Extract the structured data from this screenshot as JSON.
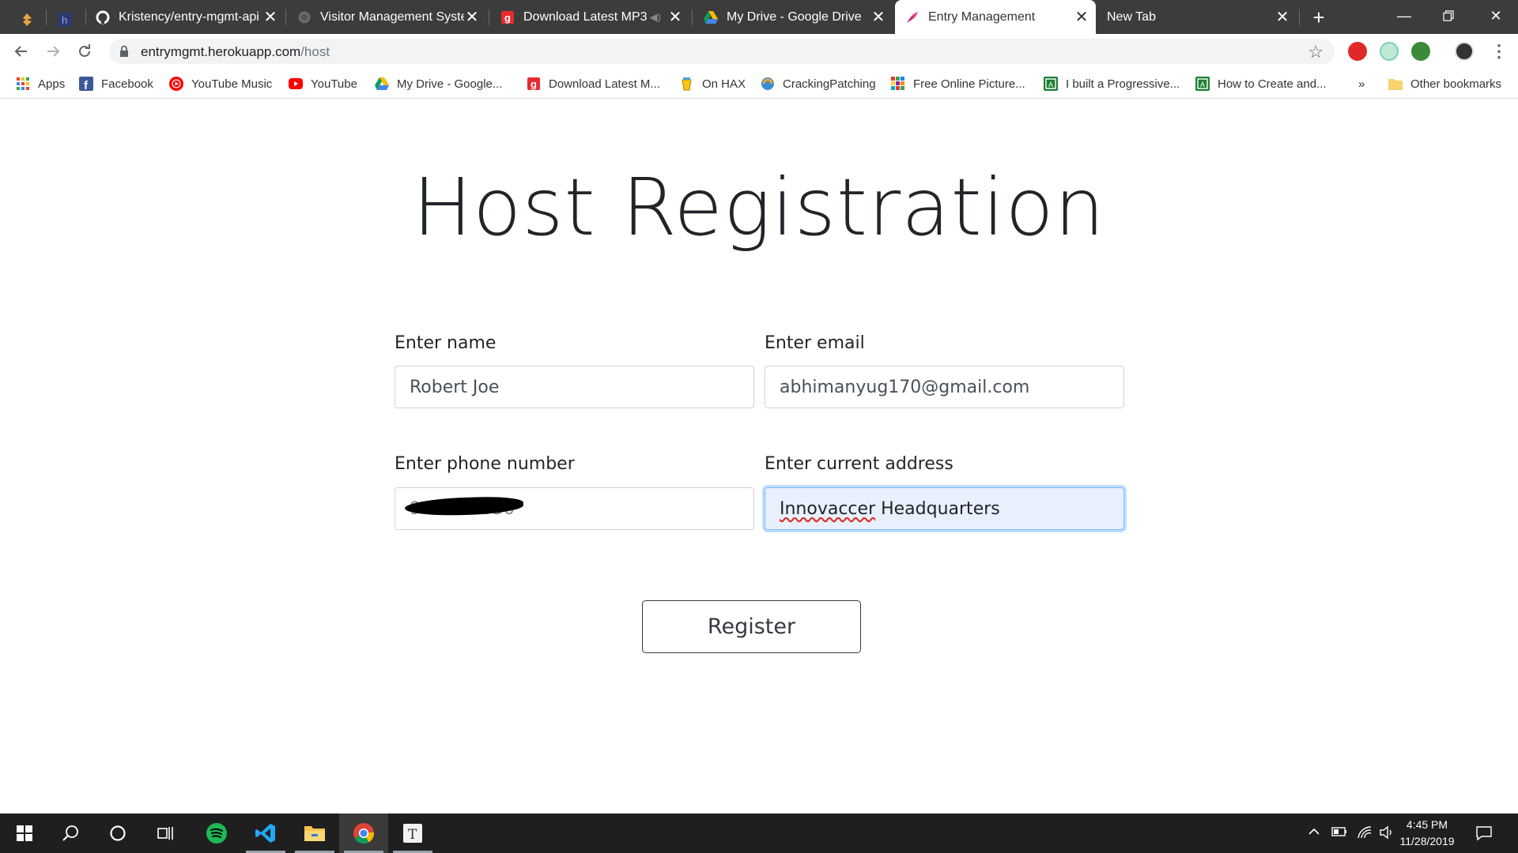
{
  "browser": {
    "tabs": [
      {
        "title": "Kristency/entry-mgmt-api",
        "icon": "github-icon"
      },
      {
        "title": "Visitor Management Syste",
        "icon": "globe-icon"
      },
      {
        "title": "Download Latest MP3",
        "icon": "gaana-icon"
      },
      {
        "title": "My Drive - Google Drive",
        "icon": "google-drive-icon"
      },
      {
        "title": "Entry Management",
        "icon": "feather-icon",
        "active": true
      },
      {
        "title": "New Tab",
        "icon": ""
      }
    ],
    "close_glyph": "✕",
    "url_host": "entrymgmt.herokuapp.com",
    "url_path": "/host",
    "bookmarks": [
      {
        "label": "Apps",
        "icon": "apps-grid-icon"
      },
      {
        "label": "Facebook",
        "icon": "facebook-icon"
      },
      {
        "label": "YouTube Music",
        "icon": "youtube-music-icon"
      },
      {
        "label": "YouTube",
        "icon": "youtube-icon"
      },
      {
        "label": "My Drive - Google...",
        "icon": "google-drive-icon"
      },
      {
        "label": "Download Latest M...",
        "icon": "gaana-icon"
      },
      {
        "label": "On HAX",
        "icon": "cup-icon"
      },
      {
        "label": "CrackingPatching",
        "icon": "crackingpatching-icon"
      },
      {
        "label": "Free Online Picture...",
        "icon": "picture-grid-icon"
      },
      {
        "label": "I built a Progressive...",
        "icon": "bookmark-green-icon"
      },
      {
        "label": "How to Create and...",
        "icon": "bookmark-green-icon"
      }
    ],
    "bookmarks_overflow": "»",
    "other_bookmarks": "Other bookmarks"
  },
  "page": {
    "title": "Host Registration",
    "fields": {
      "name": {
        "label": "Enter name",
        "value": "Robert Joe"
      },
      "email": {
        "label": "Enter email",
        "value": "abhimanyug170@gmail.com"
      },
      "phone": {
        "label": "Enter phone number",
        "value": "94150...950"
      },
      "address": {
        "label": "Enter current address",
        "value_misspelled": "Innovaccer",
        "value_rest": " Headquarters"
      }
    },
    "register_button": "Register"
  },
  "taskbar": {
    "time": "4:45 PM",
    "date": "11/28/2019"
  },
  "colors": {
    "tabstrip": "#3c3c3c",
    "taskbar": "#1f1f1f",
    "focus_fill": "#e8f0fe",
    "focus_border": "#80bdff"
  }
}
